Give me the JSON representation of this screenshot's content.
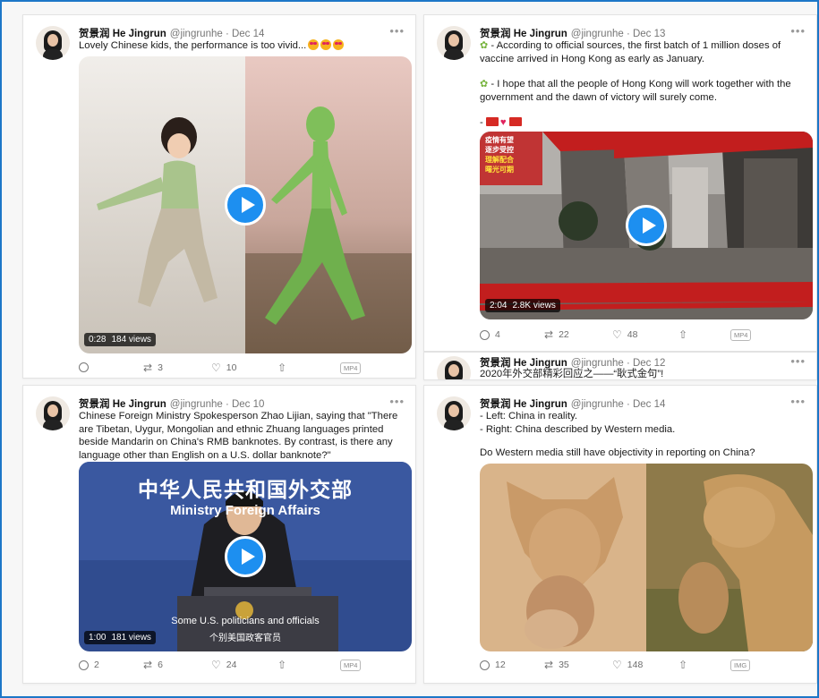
{
  "tweets": [
    {
      "name": "贺景润 He Jingrun",
      "meta": "@jingrunhe · Dec 14",
      "text": "Lovely Chinese kids, the performance is too vivid...",
      "video": {
        "duration": "0:28",
        "views": "184 views"
      },
      "actions": {
        "reply": "",
        "retweets": "3",
        "likes": "10",
        "badge": "MP4"
      }
    },
    {
      "name": "贺景润 He Jingrun",
      "meta": "@jingrunhe · Dec 13",
      "line1": "- According to official sources, the first batch of 1 million doses of vaccine arrived in Hong Kong as early as January.",
      "line2": "- I hope that all the people of Hong Kong will work together with the government and the dawn of victory will surely come.",
      "line3": "-",
      "overlay": [
        "疫情有望",
        "逐步受控",
        "理解配合",
        "曙光可期"
      ],
      "video": {
        "duration": "2:04",
        "views": "2.8K views"
      },
      "actions": {
        "reply": "4",
        "retweets": "22",
        "likes": "48",
        "badge": "MP4"
      }
    },
    {
      "name": "贺景润 He Jingrun",
      "meta": "@jingrunhe · Dec 12",
      "text": "2020年外交部精彩回应之——“耿式金句”!"
    },
    {
      "name": "贺景润 He Jingrun",
      "meta": "@jingrunhe · Dec 10",
      "text": "Chinese Foreign Ministry Spokesperson Zhao Lijian, saying that \"There are Tibetan, Uygur, Mongolian and ethnic Zhuang languages printed beside Mandarin on China's RMB banknotes. By contrast, is there any language other than English on a U.S. dollar banknote?\"",
      "banner_cn": "中华人民共和国外交部",
      "banner_en": "Ministry  Foreign Affairs",
      "sub_en": "Some U.S. politicians and officials",
      "sub_cn": "个别美国政客官员",
      "video": {
        "duration": "1:00",
        "views": "181 views"
      },
      "actions": {
        "reply": "2",
        "retweets": "6",
        "likes": "24",
        "badge": "MP4"
      }
    },
    {
      "name": "贺景润 He Jingrun",
      "meta": "@jingrunhe · Dec 14",
      "line1": "- Left: China in reality.",
      "line2": "- Right: China described by Western media.",
      "line3": "Do Western media still have objectivity in reporting on China?",
      "actions": {
        "reply": "12",
        "retweets": "35",
        "likes": "148",
        "badge": "IMG"
      }
    }
  ],
  "colors": {
    "accent": "#1d8ff0",
    "frame": "#1d77c8"
  }
}
